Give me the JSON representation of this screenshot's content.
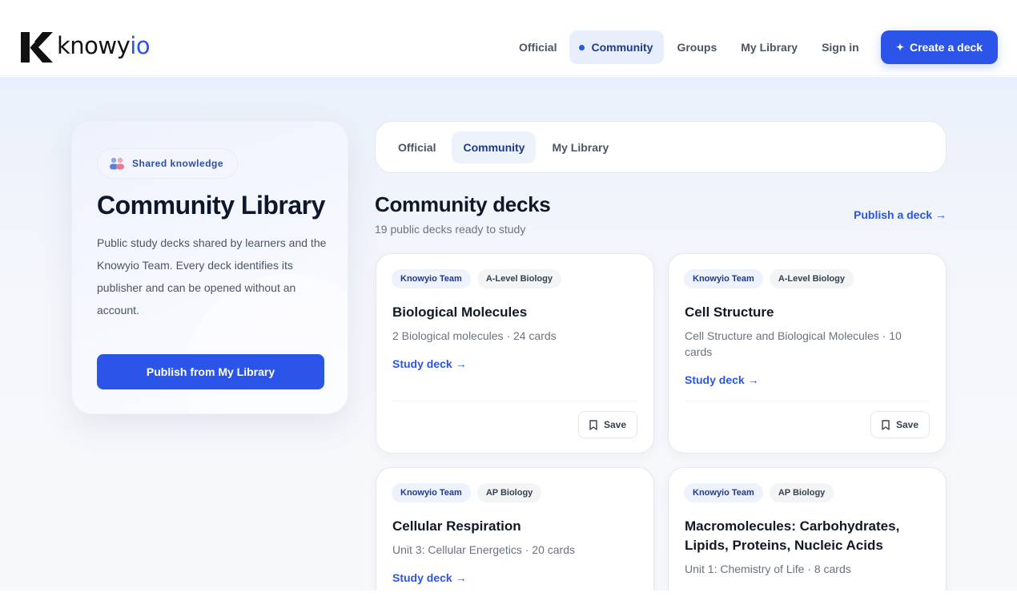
{
  "brand": {
    "name_part1": "knowy",
    "name_part2": "io"
  },
  "nav": {
    "items": [
      {
        "label": "Official"
      },
      {
        "label": "Community"
      },
      {
        "label": "Groups"
      },
      {
        "label": "My Library"
      },
      {
        "label": "Sign in"
      }
    ],
    "create_label": "Create a deck"
  },
  "hero": {
    "badge": "Shared knowledge",
    "title": "Community Library",
    "description": "Public study decks shared by learners and the Knowyio Team. Every deck identifies its publisher and can be opened without an account.",
    "button": "Publish from My Library"
  },
  "tabs": [
    {
      "label": "Official"
    },
    {
      "label": "Community"
    },
    {
      "label": "My Library"
    }
  ],
  "section": {
    "title": "Community decks",
    "subtitle": "19 public decks ready to study",
    "publish_link": "Publish a deck →"
  },
  "decks": [
    {
      "publisher": "Knowyio Team",
      "subject": "A-Level Biology",
      "title": "Biological Molecules",
      "meta": "2 Biological molecules · 24 cards",
      "study": "Study deck →",
      "save": "Save"
    },
    {
      "publisher": "Knowyio Team",
      "subject": "A-Level Biology",
      "title": "Cell Structure",
      "meta": "Cell Structure and Biological Molecules · 10 cards",
      "study": "Study deck →",
      "save": "Save"
    },
    {
      "publisher": "Knowyio Team",
      "subject": "AP Biology",
      "title": "Cellular Respiration",
      "meta": "Unit 3: Cellular Energetics · 20 cards",
      "study": "Study deck →"
    },
    {
      "publisher": "Knowyio Team",
      "subject": "AP Biology",
      "title": "Macromolecules: Carbohydrates, Lipids, Proteins, Nucleic Acids",
      "meta": "Unit 1: Chemistry of Life · 8 cards"
    }
  ],
  "colors": {
    "accent": "#2b54e8",
    "accent_dark": "#1e3a8a"
  }
}
